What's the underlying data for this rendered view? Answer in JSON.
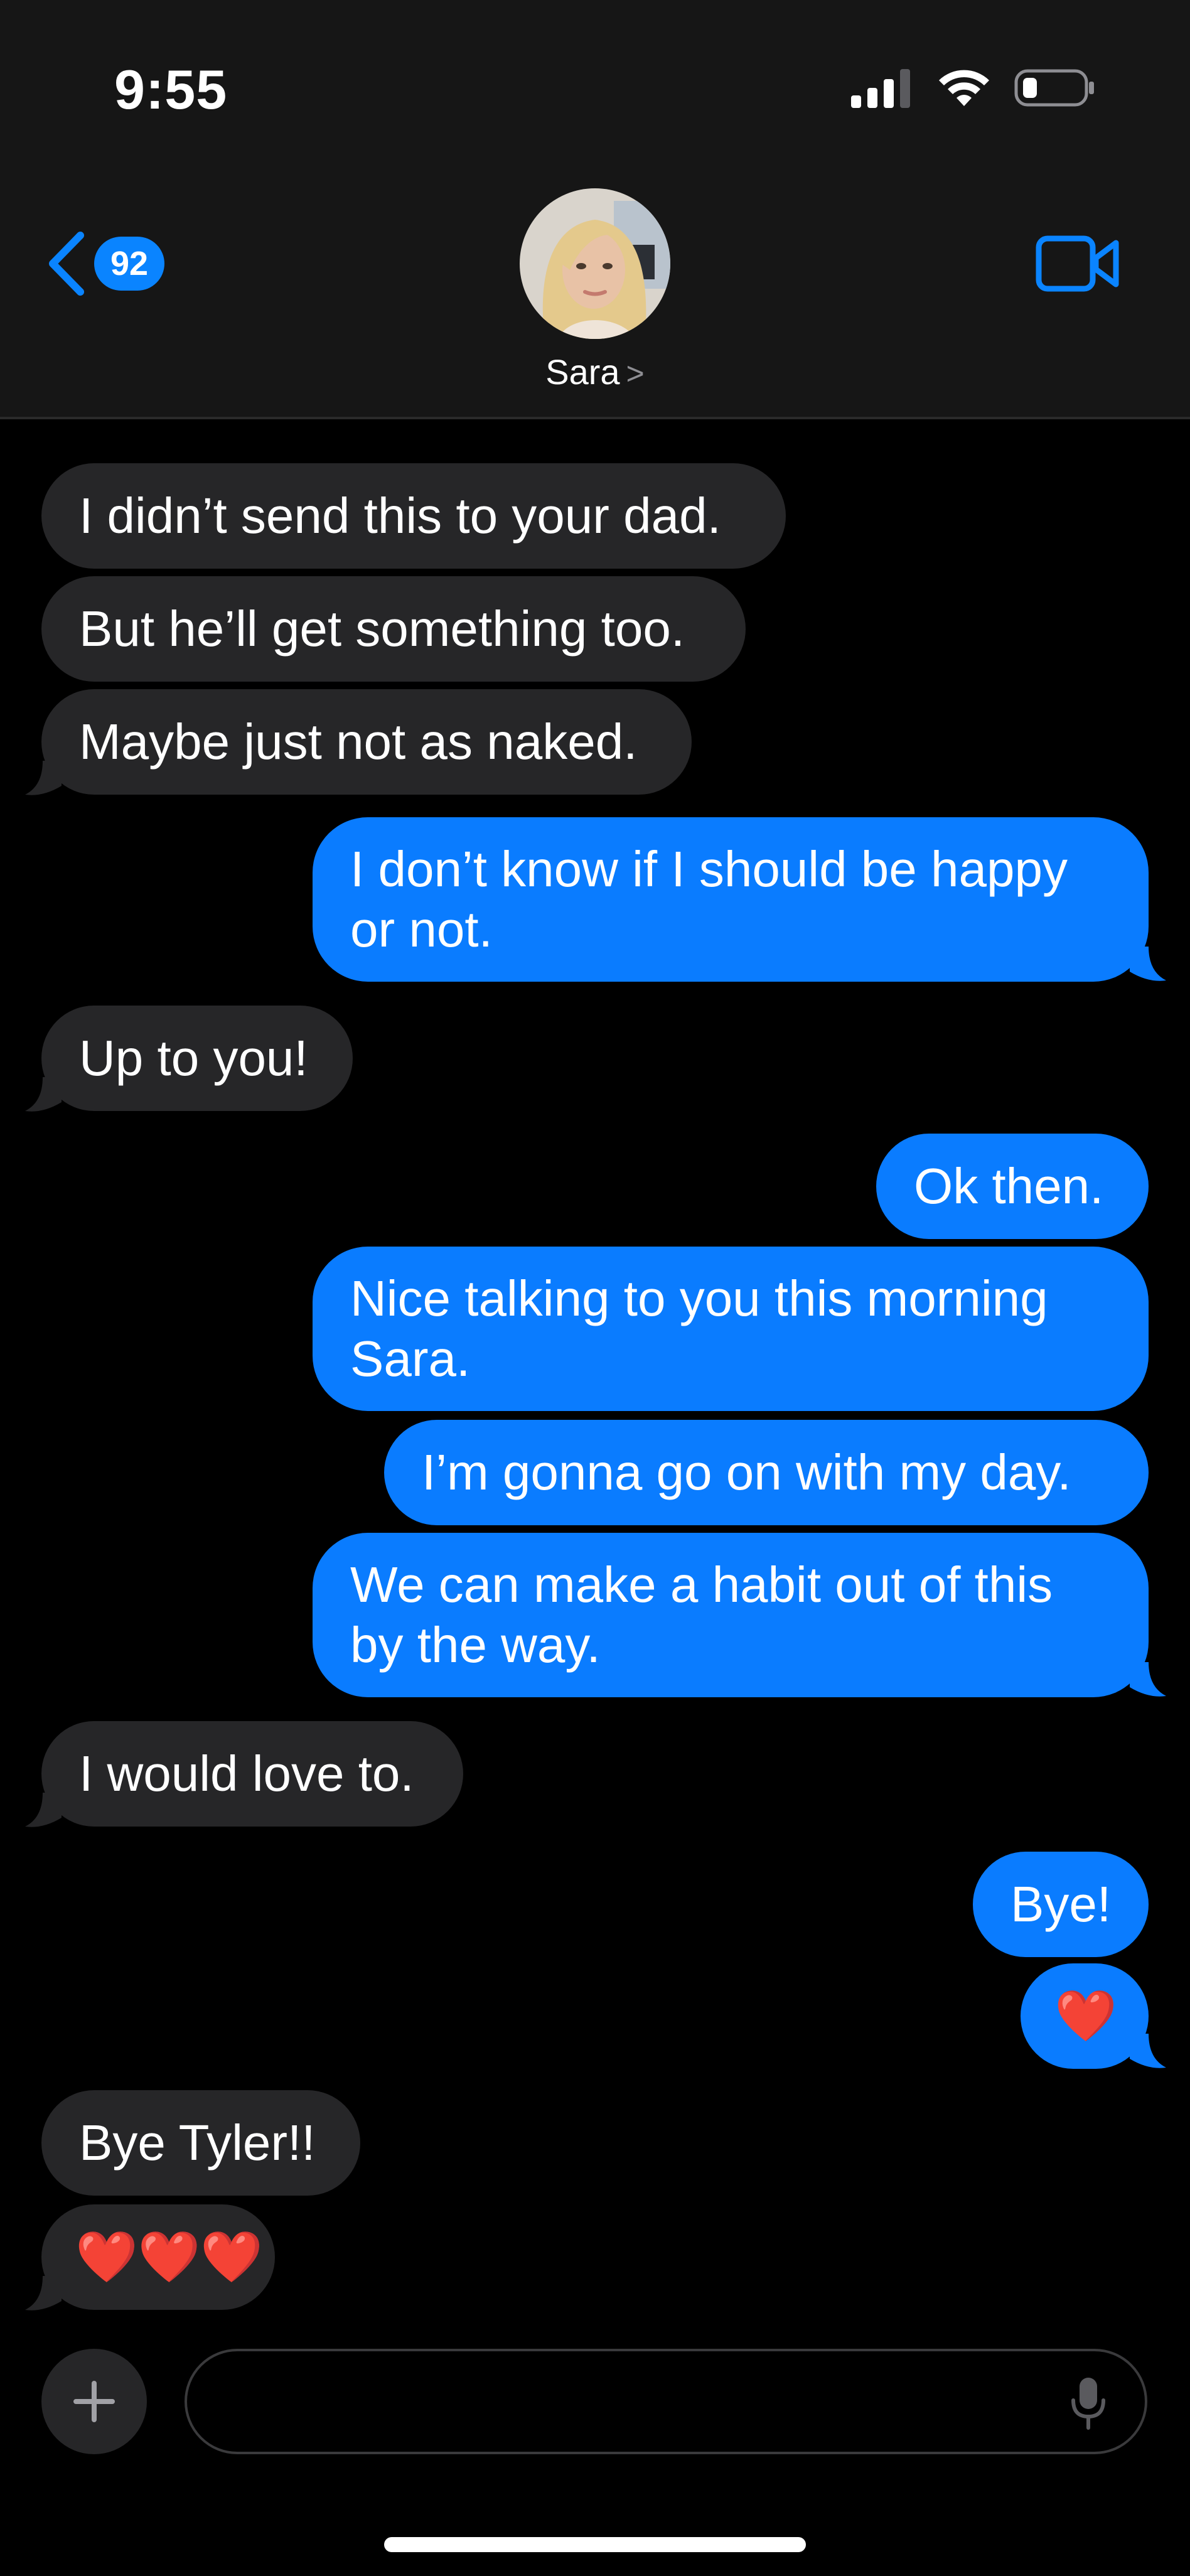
{
  "status_bar": {
    "time": "9:55"
  },
  "nav": {
    "back_count": "92",
    "contact_name": "Sara",
    "chevron": ">"
  },
  "messages": [
    {
      "dir": "in",
      "text": "I didn’t send this to your dad."
    },
    {
      "dir": "in",
      "text": "But he’ll get something too."
    },
    {
      "dir": "in",
      "text": "Maybe just not as naked."
    },
    {
      "dir": "out",
      "text": "I don’t know if I should be happy\nor not."
    },
    {
      "dir": "in",
      "text": "Up to you!"
    },
    {
      "dir": "out",
      "text": "Ok then."
    },
    {
      "dir": "out",
      "text": "Nice talking to you this morning\nSara."
    },
    {
      "dir": "out",
      "text": "I’m gonna go on with my day."
    },
    {
      "dir": "out",
      "text": "We can make a habit out of this\nby the way."
    },
    {
      "dir": "in",
      "text": "I would love to."
    },
    {
      "dir": "out",
      "text": "Bye!"
    },
    {
      "dir": "out",
      "text": "❤️"
    },
    {
      "dir": "in",
      "text": "Bye Tyler!!"
    },
    {
      "dir": "in",
      "text": "❤️❤️❤️"
    }
  ],
  "composer": {
    "placeholder": ""
  },
  "colors": {
    "accent": "#0a84ff",
    "outgoing_bubble": "#0a7cff",
    "incoming_bubble": "#262628",
    "header_bg": "#161616",
    "background": "#000000"
  },
  "icons": {
    "back": "chevron-left-icon",
    "video": "video-camera-icon",
    "plus": "plus-icon",
    "mic": "microphone-icon",
    "signal": "cellular-signal-icon",
    "wifi": "wifi-icon",
    "battery": "battery-icon"
  }
}
